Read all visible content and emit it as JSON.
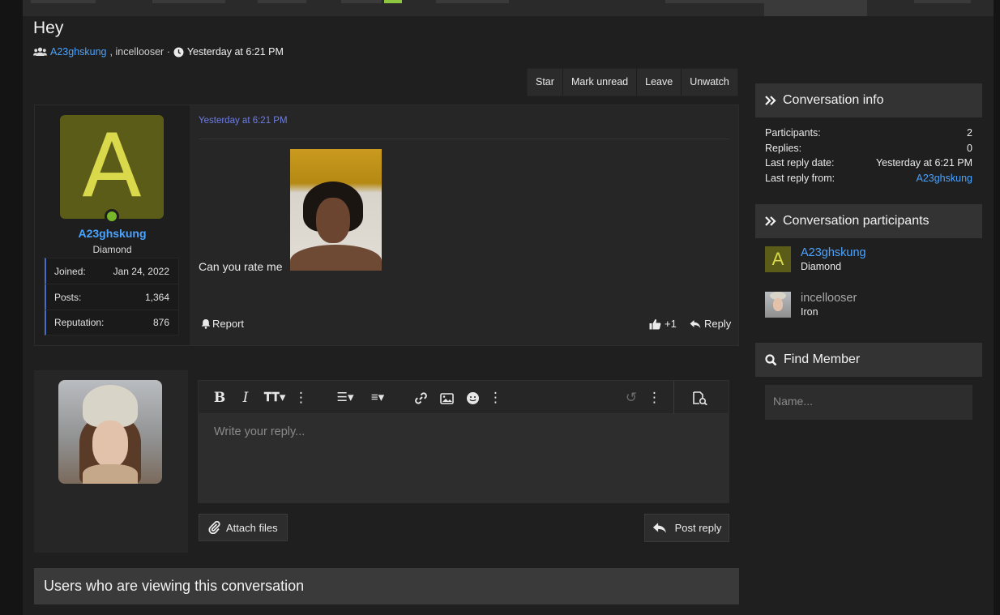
{
  "thread": {
    "title": "Hey",
    "starter": "A23ghskung",
    "participants_rest": ", incellooser ·",
    "date": "Yesterday at 6:21 PM"
  },
  "actions": [
    "Star",
    "Mark unread",
    "Leave",
    "Unwatch"
  ],
  "message": {
    "date": "Yesterday at 6:21 PM",
    "avatar_letter": "A",
    "username": "A23ghskung",
    "user_title": "Diamond",
    "stats": [
      {
        "label": "Joined:",
        "value": "Jan 24, 2022"
      },
      {
        "label": "Posts:",
        "value": "1,364"
      },
      {
        "label": "Reputation:",
        "value": "876"
      }
    ],
    "text": "Can you rate me",
    "report_label": "Report",
    "likes": "+1",
    "reply_label": "Reply"
  },
  "composer": {
    "placeholder": "Write your reply...",
    "attach_label": "Attach files",
    "post_label": "Post reply"
  },
  "viewing_heading": "Users who are viewing this conversation",
  "sidebar": {
    "info_title": "Conversation info",
    "info": [
      {
        "label": "Participants:",
        "value": "2"
      },
      {
        "label": "Replies:",
        "value": "0"
      },
      {
        "label": "Last reply date:",
        "value": "Yesterday at 6:21 PM"
      },
      {
        "label": "Last reply from:",
        "value": "A23ghskung"
      }
    ],
    "participants_title": "Conversation participants",
    "participants": [
      {
        "name": "A23ghskung",
        "rank": "Diamond",
        "avatar_letter": "A"
      },
      {
        "name": "incellooser",
        "rank": "Iron"
      }
    ],
    "find_title": "Find Member",
    "find_placeholder": "Name..."
  },
  "colors": {
    "link": "#4aa3ff",
    "avatar_bg": "#5c5c19",
    "avatar_fg": "#d9d94b",
    "online": "#76b82a"
  }
}
